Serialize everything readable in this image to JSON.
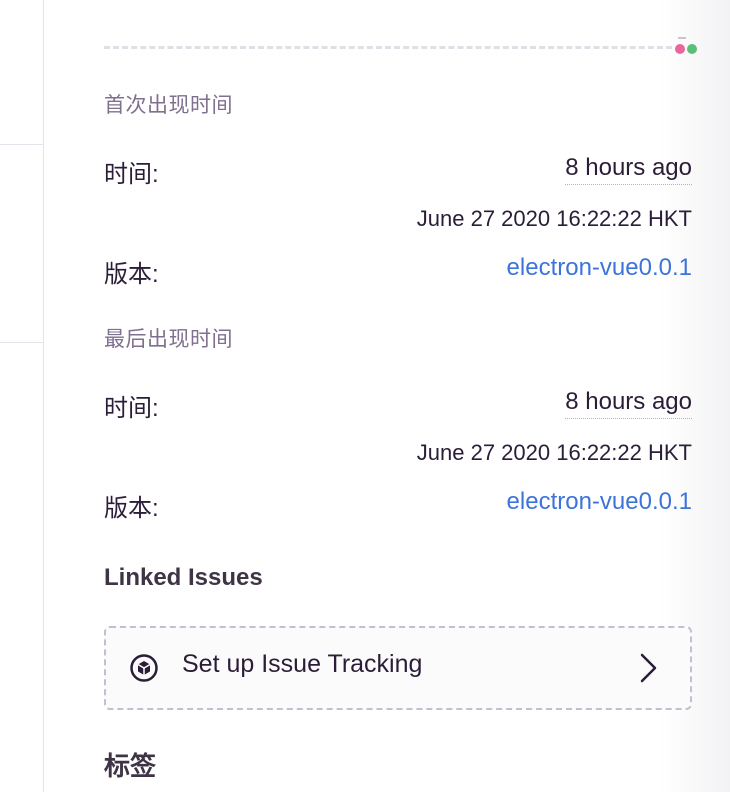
{
  "first_seen": {
    "heading": "首次出现时间",
    "time_label": "时间:",
    "time_relative": "8 hours ago",
    "time_absolute": "June 27 2020 16:22:22 HKT",
    "version_label": "版本:",
    "version_value": "electron-vue0.0.1"
  },
  "last_seen": {
    "heading": "最后出现时间",
    "time_label": "时间:",
    "time_relative": "8 hours ago",
    "time_absolute": "June 27 2020 16:22:22 HKT",
    "version_label": "版本:",
    "version_value": "electron-vue0.0.1"
  },
  "linked_issues": {
    "title": "Linked Issues",
    "setup_label": "Set up Issue Tracking"
  },
  "tags": {
    "title": "标签"
  },
  "icons": {
    "tracking": "cube-icon",
    "chevron": "chevron-right-icon"
  },
  "colors": {
    "link": "#3d74db",
    "text": "#2b1d38",
    "muted": "#80708f",
    "dot_pink": "#e8669c",
    "dot_green": "#5bbf77"
  }
}
